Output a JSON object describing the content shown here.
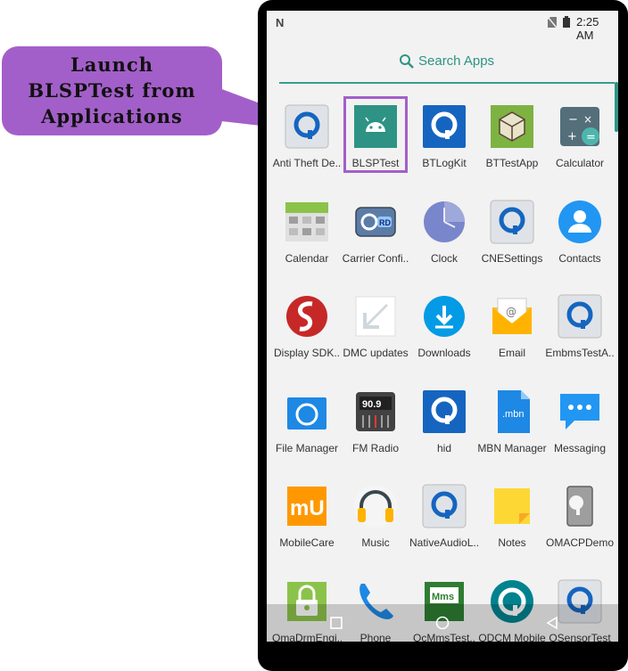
{
  "callout": {
    "text": "Launch\nBLSPTest from\nApplications"
  },
  "status_bar": {
    "notification_glyph": "N",
    "time": "2:25 AM"
  },
  "search": {
    "label": "Search Apps"
  },
  "apps": [
    {
      "label": "Anti Theft De..",
      "icon": "qualcomm-q-icon"
    },
    {
      "label": "BLSPTest",
      "icon": "android-icon"
    },
    {
      "label": "BTLogKit",
      "icon": "qualcomm-q-icon"
    },
    {
      "label": "BTTestApp",
      "icon": "cube-icon"
    },
    {
      "label": "Calculator",
      "icon": "calculator-icon"
    },
    {
      "label": "Calendar",
      "icon": "calendar-icon"
    },
    {
      "label": "Carrier Confi..",
      "icon": "carrier-config-icon"
    },
    {
      "label": "Clock",
      "icon": "clock-icon"
    },
    {
      "label": "CNESettings",
      "icon": "qualcomm-q-icon"
    },
    {
      "label": "Contacts",
      "icon": "contacts-icon"
    },
    {
      "label": "Display SDK..",
      "icon": "snapdragon-icon"
    },
    {
      "label": "DMC updates",
      "icon": "dmc-icon"
    },
    {
      "label": "Downloads",
      "icon": "download-icon"
    },
    {
      "label": "Email",
      "icon": "email-icon"
    },
    {
      "label": "EmbmsTestA..",
      "icon": "qualcomm-q-icon"
    },
    {
      "label": "File Manager",
      "icon": "folder-icon"
    },
    {
      "label": "FM Radio",
      "icon": "radio-icon"
    },
    {
      "label": "hid",
      "icon": "qualcomm-q-icon"
    },
    {
      "label": "MBN Manager",
      "icon": "mbn-file-icon"
    },
    {
      "label": "Messaging",
      "icon": "message-icon"
    },
    {
      "label": "MobileCare",
      "icon": "mobilecare-icon"
    },
    {
      "label": "Music",
      "icon": "headphones-icon"
    },
    {
      "label": "NativeAudioL..",
      "icon": "qualcomm-q-icon"
    },
    {
      "label": "Notes",
      "icon": "notes-icon"
    },
    {
      "label": "OMACPDemo",
      "icon": "omacp-icon"
    },
    {
      "label": "OmaDrmEngi..",
      "icon": "lock-icon"
    },
    {
      "label": "Phone",
      "icon": "phone-icon"
    },
    {
      "label": "QcMmsTest..",
      "icon": "mms-icon"
    },
    {
      "label": "QDCM Mobile",
      "icon": "qdcm-icon"
    },
    {
      "label": "QSensorTest",
      "icon": "qualcomm-q-icon"
    }
  ],
  "icon_text": {
    "carrier_rd": "RD",
    "radio_freq": "90.9",
    "mbn": ".mbn",
    "mms": "Mms",
    "mobilecare": "mU"
  },
  "colors": {
    "accent": "#2e9384",
    "callout": "#a35fc9",
    "qualcomm_blue": "#1565c0"
  }
}
